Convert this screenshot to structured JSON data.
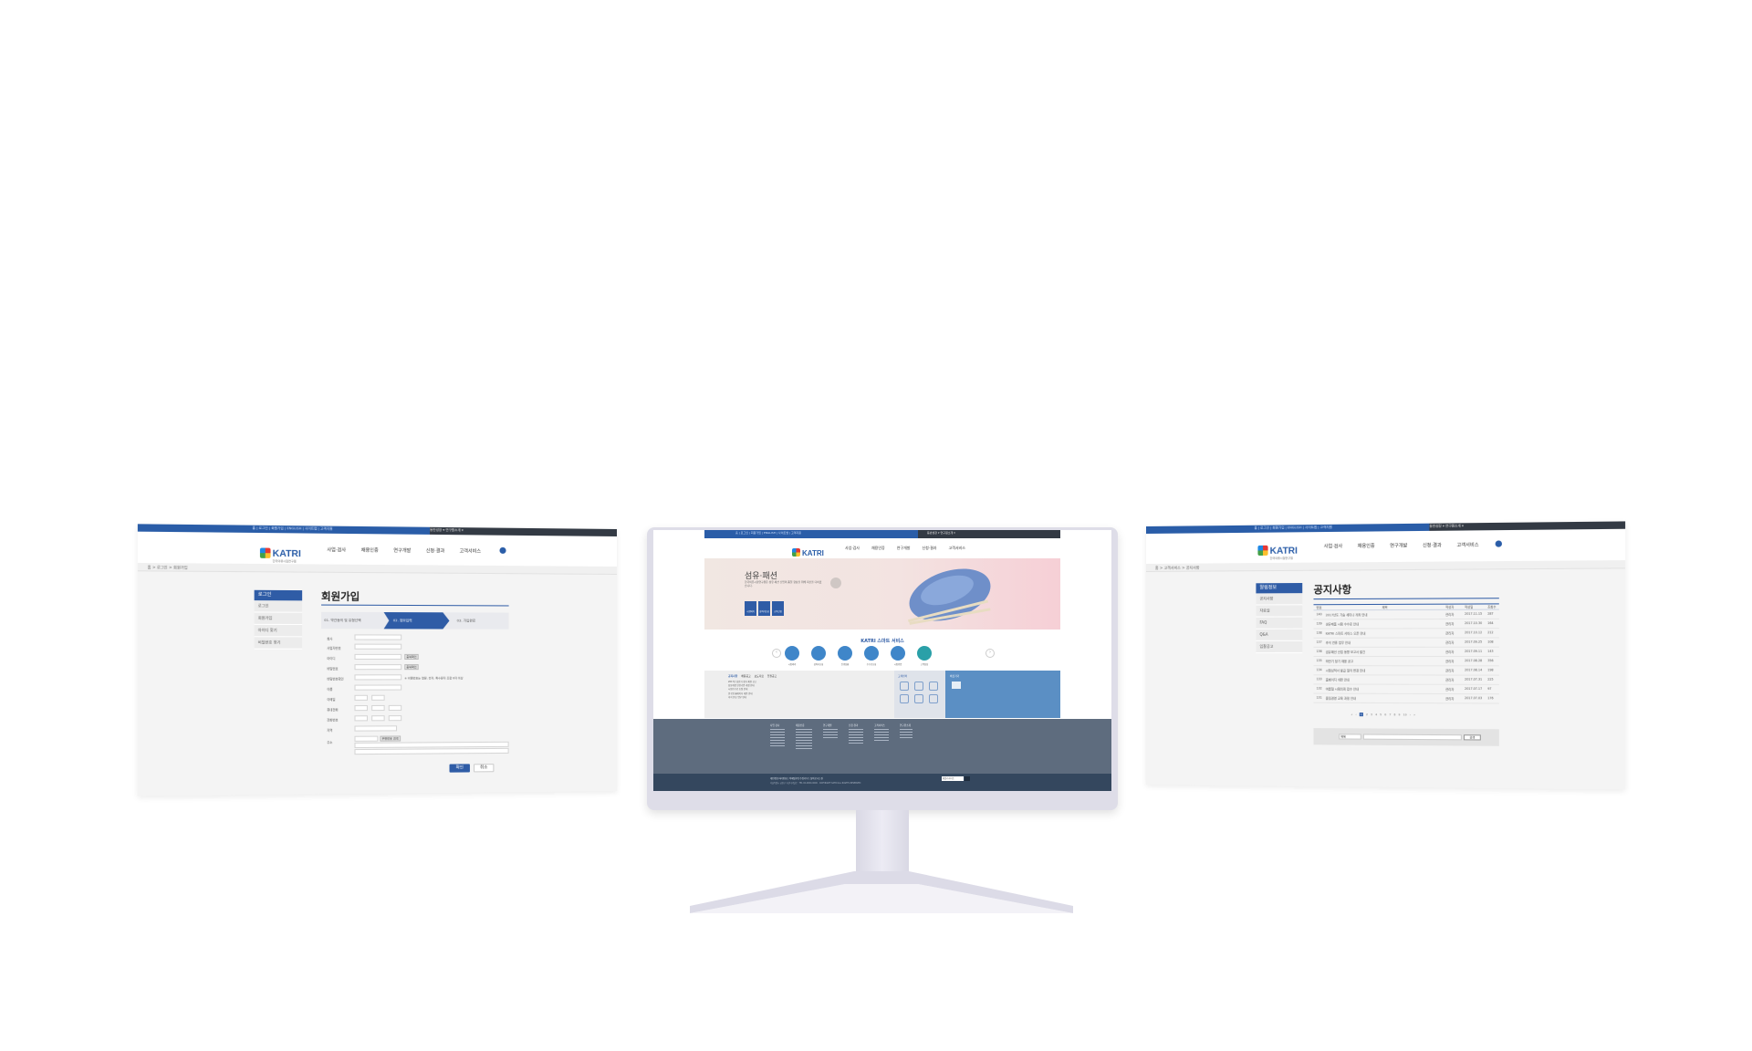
{
  "common": {
    "logo_text": "KATRI",
    "logo_sub": "한국의류시험연구원",
    "util_links": "홈 | 로그인 | 회원가입 | ENGLISH | 사이트맵 | 고객지원",
    "util_right": "동반성장 ▾   연구원소개 ▾",
    "gnb": [
      "사업·검사",
      "채용인증",
      "연구개발",
      "신청·결과",
      "고객서비스"
    ],
    "brand_blue": "#2a5da8"
  },
  "left_screen": {
    "breadcrumb": "홈 > 로그인 > 회원가입",
    "lnb_title": "로그인",
    "lnb_items": [
      "로그인",
      "회원가입",
      "아이디 찾기",
      "비밀번호 찾기"
    ],
    "title": "회원가입",
    "steps": [
      "01. 약관동의 및 유형선택",
      "02. 정보입력",
      "03. 가입완료"
    ],
    "form_labels": [
      "회사",
      "사업자번호",
      "아이디",
      "비밀번호",
      "비밀번호확인",
      "이름",
      "이메일",
      "휴대전화",
      "전화번호",
      "지역",
      "주소"
    ],
    "check_label": "중복확인",
    "note": "※ 비밀번호는 영문, 숫자, 특수문자 조합 8자 이상",
    "zip_label": "우편번호 검색",
    "ok_label": "확인",
    "cancel_label": "취소"
  },
  "monitor": {
    "hero_title": "섬유·패션",
    "hero_desc": "한국의류시험연구원은 섬유·패션 산업의 품질 향상을 위해 최선을 다하겠습니다.",
    "hero_btns": [
      "시험의뢰",
      "성적서조회",
      "교육신청"
    ],
    "services_title": "KATRI 스마트 서비스",
    "services": [
      "시험의뢰",
      "성적서조회",
      "진행상황",
      "수수료조회",
      "시험방법",
      "고객상담"
    ],
    "notice_tabs": [
      "공지사항",
      "채용공고",
      "보도자료",
      "입찰공고"
    ],
    "notice_items": [
      "2017년 상반기 정기 채용 공고",
      "섬유제품 안전기준 개정 안내",
      "시험수수료 조정 안내",
      "연구원 홈페이지 개편 안내",
      "추석 연휴 업무 안내"
    ],
    "quick_title": "고객센터",
    "quick_side_title": "바로가기",
    "footer_cols": [
      "사업·검사",
      "채용인증",
      "연구개발",
      "신청·결과",
      "고객서비스",
      "연구원소개"
    ],
    "footer_links": "개인정보처리방침 | 이메일무단수집거부 | 찾아오시는길",
    "footer_addr": "서울특별시 금천구 가산디지털로 · TEL 02-0000-0000 · COPYRIGHT KATRI ALL RIGHTS RESERVED",
    "family_site": "패밀리사이트"
  },
  "right_screen": {
    "breadcrumb": "홈 > 고객서비스 > 공지사항",
    "lnb_title": "알림정보",
    "lnb_items": [
      "공지사항",
      "자료실",
      "FAQ",
      "Q&A",
      "입찰공고"
    ],
    "title": "공지사항",
    "table_headers": [
      "번호",
      "제목",
      "작성자",
      "작성일",
      "조회수"
    ],
    "rows": [
      [
        "140",
        "2017년도 기술 세미나 개최 안내",
        "관리자",
        "2017.11.15",
        "287"
      ],
      [
        "139",
        "섬유제품 시험 수수료 안내",
        "관리자",
        "2017.10.30",
        "164"
      ],
      [
        "138",
        "KATRI 스마트 서비스 오픈 안내",
        "관리자",
        "2017.10.12",
        "212"
      ],
      [
        "137",
        "추석 연휴 업무 안내",
        "관리자",
        "2017.09.25",
        "108"
      ],
      [
        "136",
        "섬유패션 산업 동향 보고서 발간",
        "관리자",
        "2017.09.11",
        "143"
      ],
      [
        "135",
        "하반기 정기 채용 공고",
        "관리자",
        "2017.08.28",
        "356"
      ],
      [
        "134",
        "시험성적서 발급 절차 변경 안내",
        "관리자",
        "2017.08.14",
        "198"
      ],
      [
        "133",
        "홈페이지 개편 안내",
        "관리자",
        "2017.07.31",
        "225"
      ],
      [
        "132",
        "여름철 시험의뢰 접수 안내",
        "관리자",
        "2017.07.17",
        "97"
      ],
      [
        "131",
        "품질경영 교육 과정 안내",
        "관리자",
        "2017.07.03",
        "176"
      ]
    ],
    "pages": [
      "1",
      "2",
      "3",
      "4",
      "5",
      "6",
      "7",
      "8",
      "9",
      "10"
    ],
    "search_select": "제목",
    "search_btn": "검색"
  }
}
